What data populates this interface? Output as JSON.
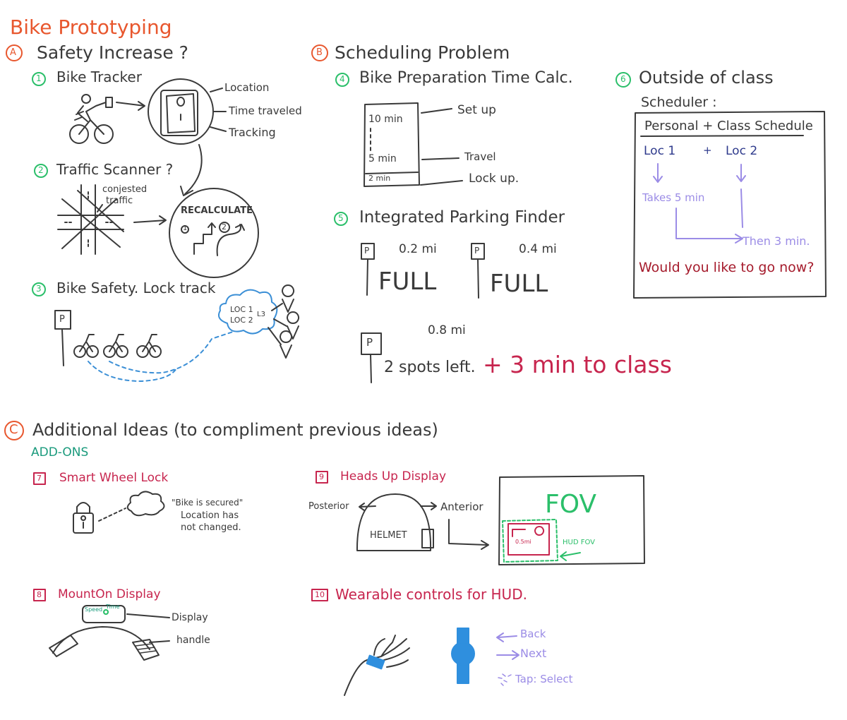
{
  "title": "Bike Prototyping",
  "colors": {
    "orange": "#e8572e",
    "green": "#2bbf6a",
    "teal": "#1a9a7c",
    "navy": "#2e3a8c",
    "purple": "#9b8ce6",
    "crimson": "#c7254e",
    "ink": "#3a3a3a",
    "blue_dash": "#3b8fd6",
    "watch_blue": "#2f8fde"
  },
  "section_a": {
    "marker": "A",
    "heading": "Safety Increase ?",
    "item1": {
      "num": "1",
      "title": "Bike Tracker",
      "labels": [
        "Location",
        "Time traveled",
        "Tracking"
      ]
    },
    "item2": {
      "num": "2",
      "title": "Traffic Scanner ?",
      "note_line1": "conjested",
      "note_line2": "traffic",
      "badge": "RECALCULATE",
      "step1": "1",
      "step2": "2"
    },
    "item3": {
      "num": "3",
      "title": "Bike Safety. Lock track",
      "parking_letter": "P",
      "cloud_line1": "LOC 1",
      "cloud_line2": "LOC 2",
      "cloud_line3": "L3"
    }
  },
  "section_b": {
    "marker": "B",
    "heading": "Scheduling Problem",
    "item4": {
      "num": "4",
      "title": "Bike Preparation Time Calc.",
      "times": [
        "10 min",
        "5 min",
        "2 min"
      ],
      "labels": [
        "Set up",
        "Travel",
        "Lock up."
      ]
    },
    "item5": {
      "num": "5",
      "title": "Integrated Parking Finder",
      "lots": [
        {
          "letter": "P",
          "distance": "0.2 mi",
          "status": "FULL"
        },
        {
          "letter": "P",
          "distance": "0.4 mi",
          "status": "FULL"
        },
        {
          "letter": "P",
          "distance": "0.8 mi",
          "status": "2 spots left."
        }
      ],
      "extra": "+ 3 min to class"
    },
    "item6": {
      "num": "6",
      "title_line1": "Outside of class",
      "title_line2": "Scheduler :",
      "box_title": "Personal + Class Schedule",
      "loc1": "Loc 1",
      "plus": "+",
      "loc2": "Loc 2",
      "takes": "Takes 5 min",
      "then": "Then 3 min.",
      "question": "Would you like to go now?"
    }
  },
  "section_c": {
    "marker": "C",
    "heading": "Additional Ideas (to compliment previous ideas)",
    "subheading": "ADD-ONS",
    "item7": {
      "num": "7",
      "title": "Smart Wheel Lock",
      "quote_line1": "\"Bike is secured\"",
      "quote_line2": "Location has",
      "quote_line3": "not changed."
    },
    "item8": {
      "num": "8",
      "title": "MountOn Display",
      "screen_left": "Speed",
      "screen_right": "Time",
      "label_display": "Display",
      "label_handle": "handle"
    },
    "item9": {
      "num": "9",
      "title": "Heads Up Display",
      "posterior": "Posterior",
      "anterior": "Anterior",
      "helmet": "HELMET",
      "fov": "FOV",
      "hud_fov": "HUD FOV",
      "mini_dist": "0.5mi"
    },
    "item10": {
      "num": "10",
      "title": "Wearable controls for HUD.",
      "back": "Back",
      "next": "Next",
      "tap": "Tap: Select"
    }
  }
}
